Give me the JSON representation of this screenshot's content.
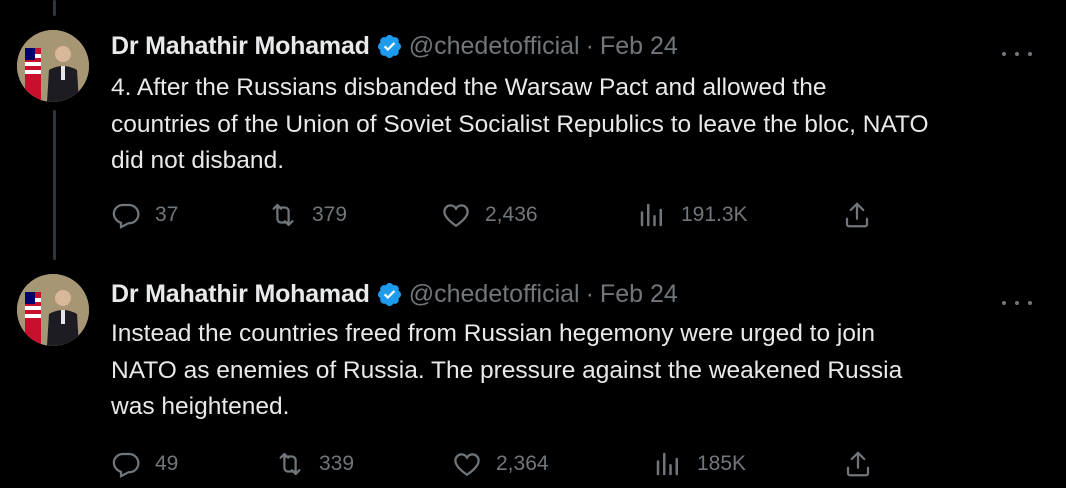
{
  "tweets": [
    {
      "author": {
        "name": "Dr Mahathir Mohamad",
        "handle": "@chedetofficial",
        "verified": true
      },
      "separator": "·",
      "date": "Feb 24",
      "text": [
        "4. After the Russians disbanded the Warsaw Pact and allowed the",
        "countries of the Union of Soviet Socialist Republics to leave the bloc, NATO",
        "did not disband."
      ],
      "stats": {
        "replies": "37",
        "retweets": "379",
        "likes": "2,436",
        "views": "191.3K"
      }
    },
    {
      "author": {
        "name": "Dr Mahathir Mohamad",
        "handle": "@chedetofficial",
        "verified": true
      },
      "separator": "·",
      "date": "Feb 24",
      "text": [
        "Instead the countries freed from Russian hegemony were urged to join",
        "NATO as enemies of Russia. The pressure against the weakened Russia",
        "was heightened."
      ],
      "stats": {
        "replies": "49",
        "retweets": "339",
        "likes": "2,364",
        "views": "185K"
      }
    }
  ],
  "colors": {
    "background": "#000000",
    "text": "#e7e9ea",
    "muted": "#71767b",
    "verified": "#1d9bf0",
    "thread_line": "#333639"
  },
  "icons": [
    "reply-icon",
    "retweet-icon",
    "like-icon",
    "views-icon",
    "share-icon",
    "more-icon",
    "verified-badge-icon"
  ]
}
